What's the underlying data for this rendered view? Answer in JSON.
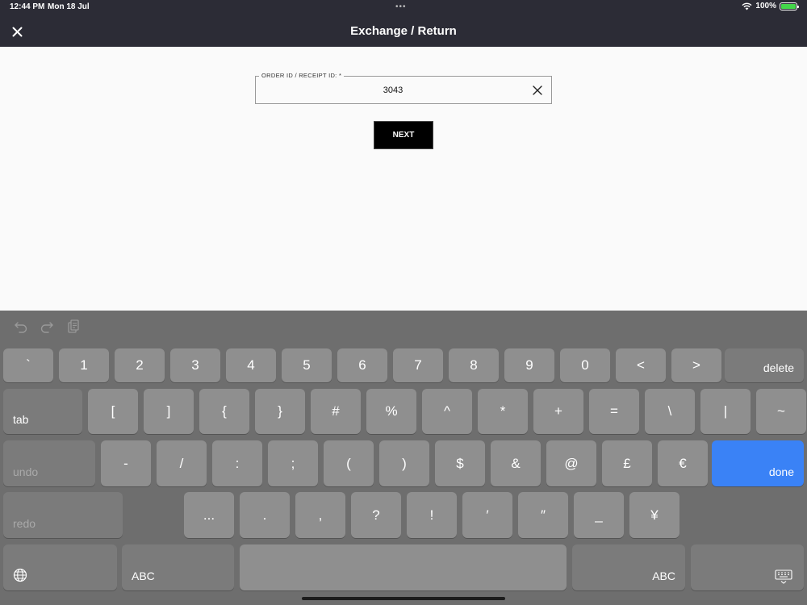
{
  "status_bar": {
    "time": "12:44 PM",
    "date": "Mon 18 Jul",
    "dots": "•••",
    "battery_percent": "100%",
    "battery_level": 1.0
  },
  "header": {
    "title": "Exchange / Return",
    "close_icon": "close-icon"
  },
  "form": {
    "order_label": "ORDER ID / RECEIPT ID: *",
    "order_value": "3043",
    "next_label": "NEXT"
  },
  "keyboard": {
    "row1": [
      "`",
      "1",
      "2",
      "3",
      "4",
      "5",
      "6",
      "7",
      "8",
      "9",
      "0",
      "<",
      ">"
    ],
    "delete_label": "delete",
    "tab_label": "tab",
    "row2": [
      "[",
      "]",
      "{",
      "}",
      "#",
      "%",
      "^",
      "*",
      "+",
      "=",
      "\\",
      "|",
      "~"
    ],
    "undo_label": "undo",
    "row3": [
      "-",
      "/",
      ":",
      ";",
      "(",
      ")",
      "$",
      "&",
      "@",
      "£",
      "€"
    ],
    "done_label": "done",
    "redo_label": "redo",
    "row4": [
      "...",
      ".",
      ",",
      "?",
      "!",
      "′",
      "″",
      "_",
      "¥"
    ],
    "abc_left_label": "ABC",
    "abc_right_label": "ABC",
    "colors": {
      "done": "#3a82f6",
      "background": "#6e6e6e",
      "key": "#8f8f8f"
    }
  }
}
